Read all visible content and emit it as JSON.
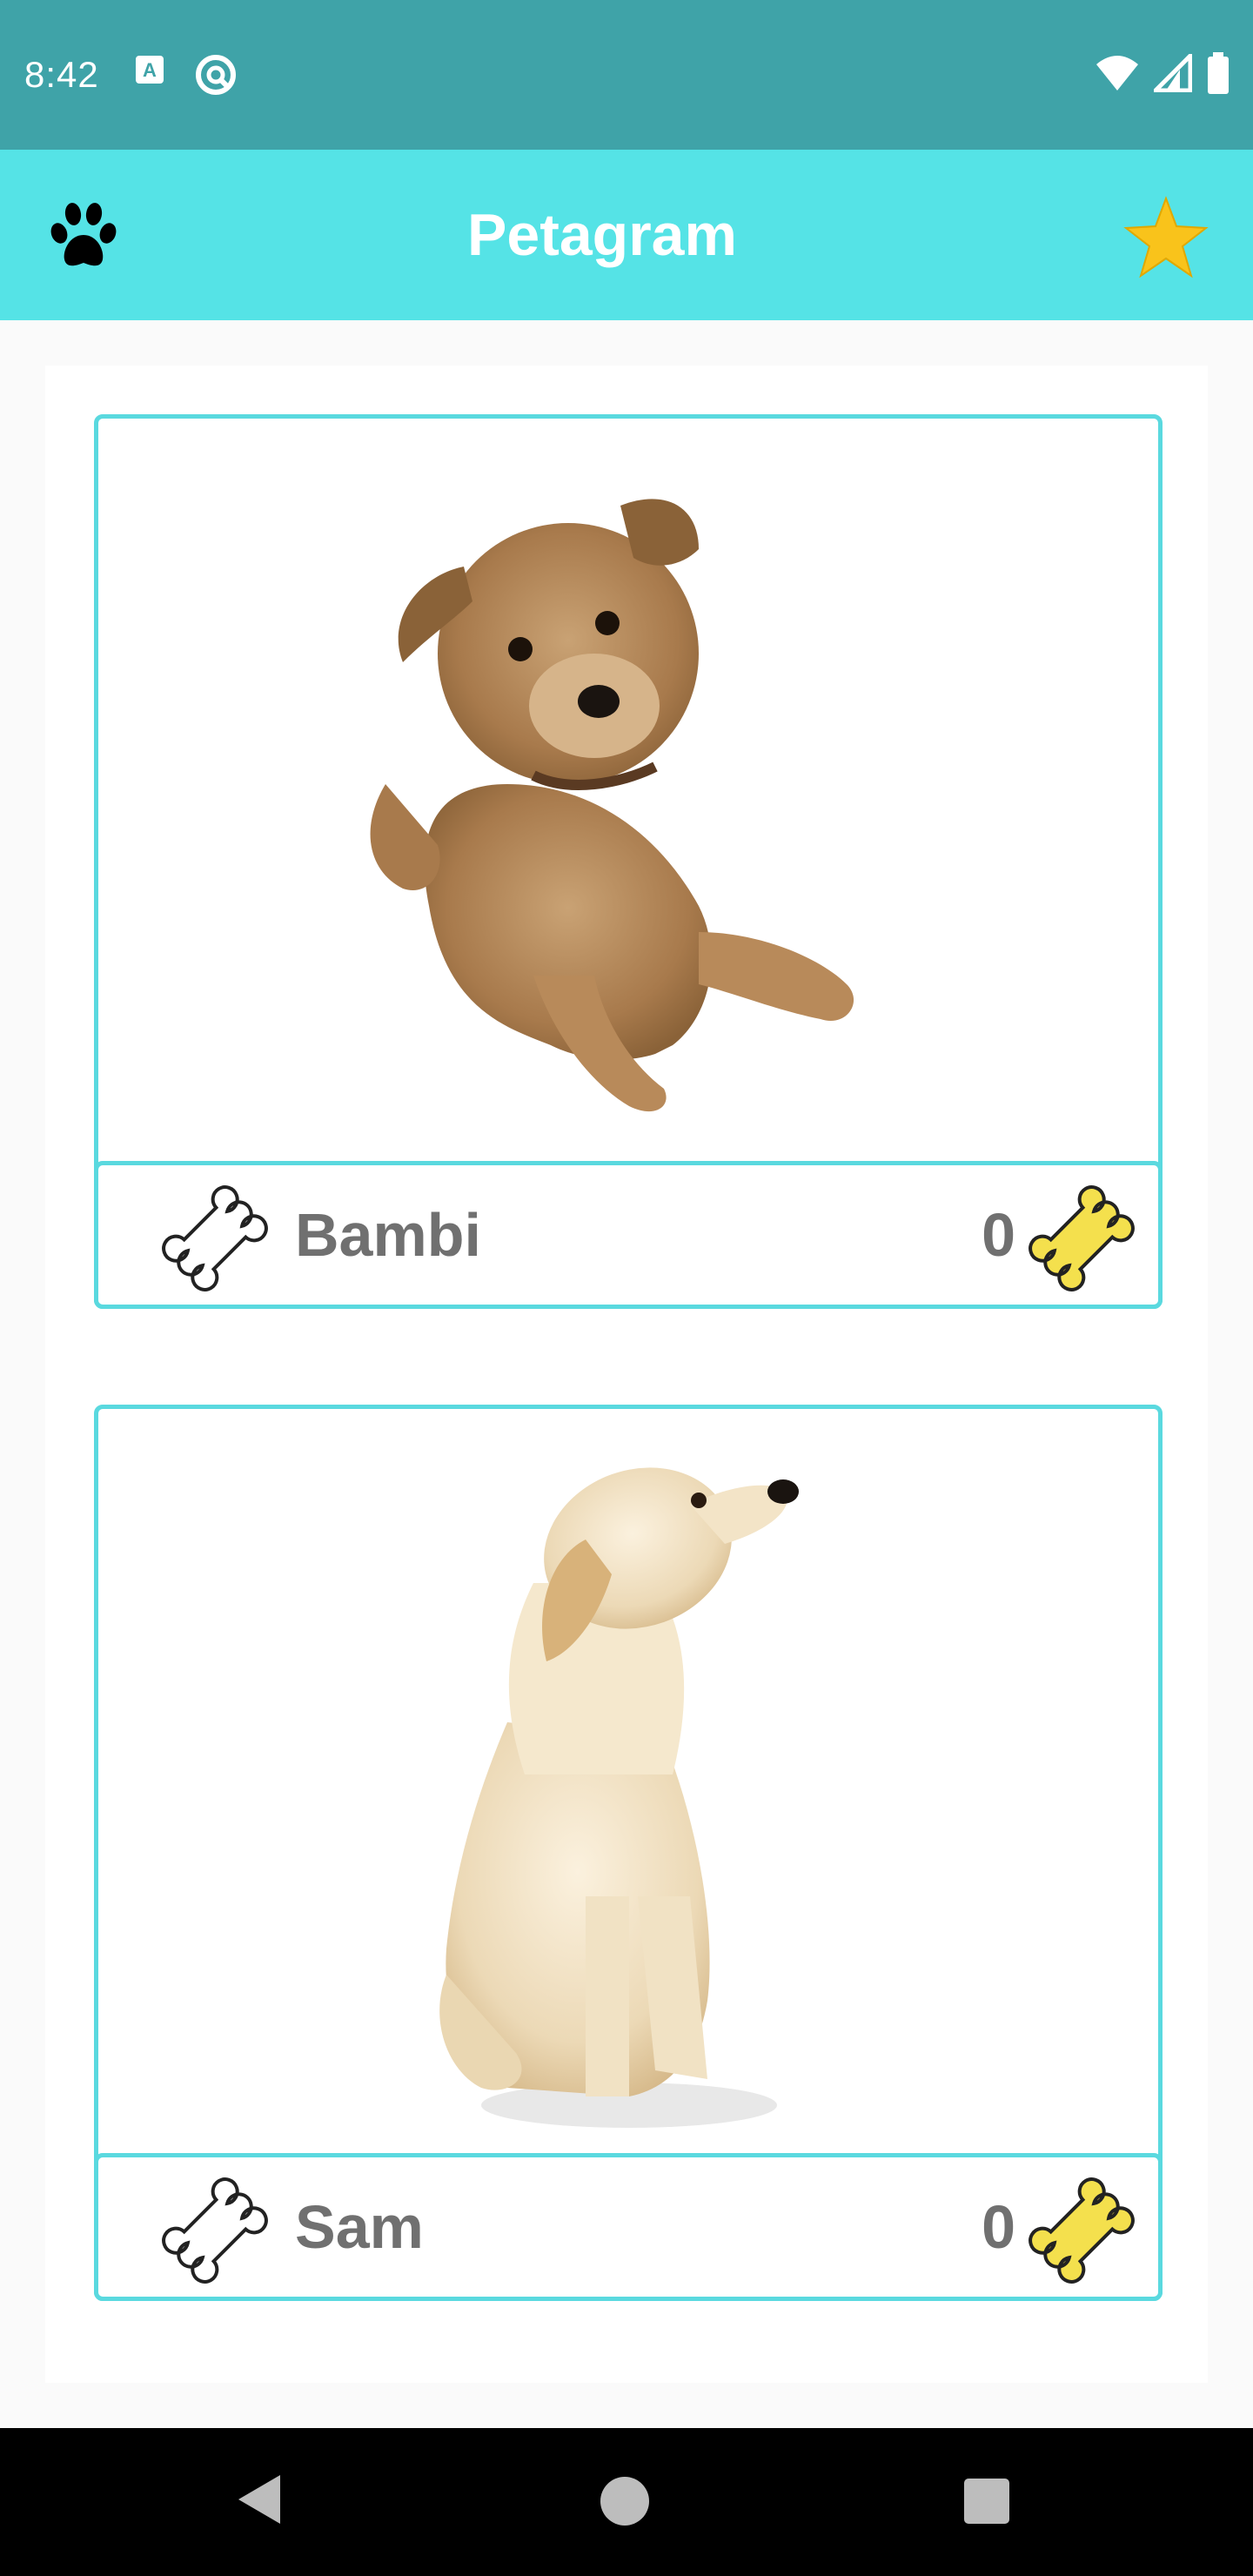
{
  "status_bar": {
    "time": "8:42",
    "icons": [
      "text-recognition-icon",
      "sync-icon",
      "wifi-icon",
      "cellular-icon",
      "battery-icon"
    ]
  },
  "app_bar": {
    "title": "Petagram",
    "left_icon": "paw-icon",
    "right_icon": "star-icon",
    "background": "#55e3e6"
  },
  "pets": [
    {
      "name": "Bambi",
      "likes": "0",
      "image": "scruffy-terrier-dog"
    },
    {
      "name": "Sam",
      "likes": "0",
      "image": "golden-retriever-puppy-sitting"
    }
  ],
  "colors": {
    "accent": "#5ad9df",
    "status_bar": "#3fa3a8",
    "bone_filled": "#f4e04d",
    "text_gray": "#707070",
    "star": "#f9c31b"
  },
  "nav_bar": {
    "buttons": [
      "back-icon",
      "home-icon",
      "recents-icon"
    ]
  }
}
